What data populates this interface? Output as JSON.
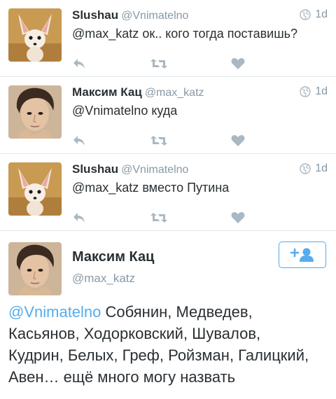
{
  "tweets": [
    {
      "name": "Slushau",
      "handle": "@Vnimatelno",
      "time": "1d",
      "mention": "@max_katz",
      "body": " ок.. кого тогда поставишь?",
      "avatar": "fox-avatar"
    },
    {
      "name": "Максим Кац",
      "handle": "@max_katz",
      "time": "1d",
      "mention": "@Vnimatelno",
      "body": " куда",
      "avatar": "person-avatar"
    },
    {
      "name": "Slushau",
      "handle": "@Vnimatelno",
      "time": "1d",
      "mention": "@max_katz",
      "body": " вместо Путина",
      "avatar": "fox-avatar"
    }
  ],
  "expanded": {
    "name": "Максим Кац",
    "handle": "@max_katz",
    "mention": "@Vnimatelno",
    "body_lines": [
      " Собянин, Медведев,",
      "Касьянов, Ходорковский, Шувалов,",
      "Кудрин, Белых, Греф, Ройзман, Галицкий,",
      "Авен… ещё много могу назвать"
    ]
  },
  "colors": {
    "accent": "#55acee",
    "muted": "#8899a6",
    "action_icon": "#aab8c2",
    "divider": "#e1e8ed"
  },
  "icons": [
    "reply-icon",
    "retweet-icon",
    "like-icon",
    "globe-icon",
    "follow-user-icon"
  ]
}
